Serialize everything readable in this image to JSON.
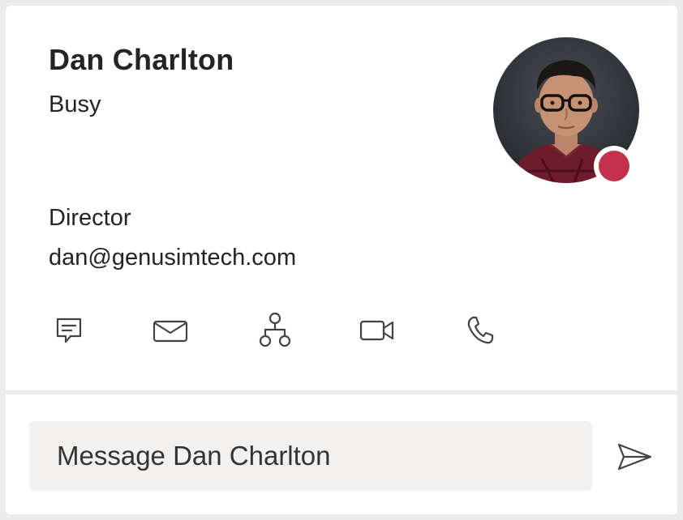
{
  "contact": {
    "name": "Dan Charlton",
    "status": "Busy",
    "title": "Director",
    "email": "dan@genusimtech.com",
    "presence_color": "#c4314b"
  },
  "actions": [
    {
      "icon": "chat-icon"
    },
    {
      "icon": "mail-icon"
    },
    {
      "icon": "org-chart-icon"
    },
    {
      "icon": "video-call-icon"
    },
    {
      "icon": "phone-icon"
    }
  ],
  "compose": {
    "text": "Message Dan Charlton",
    "send_icon": "send-icon"
  }
}
